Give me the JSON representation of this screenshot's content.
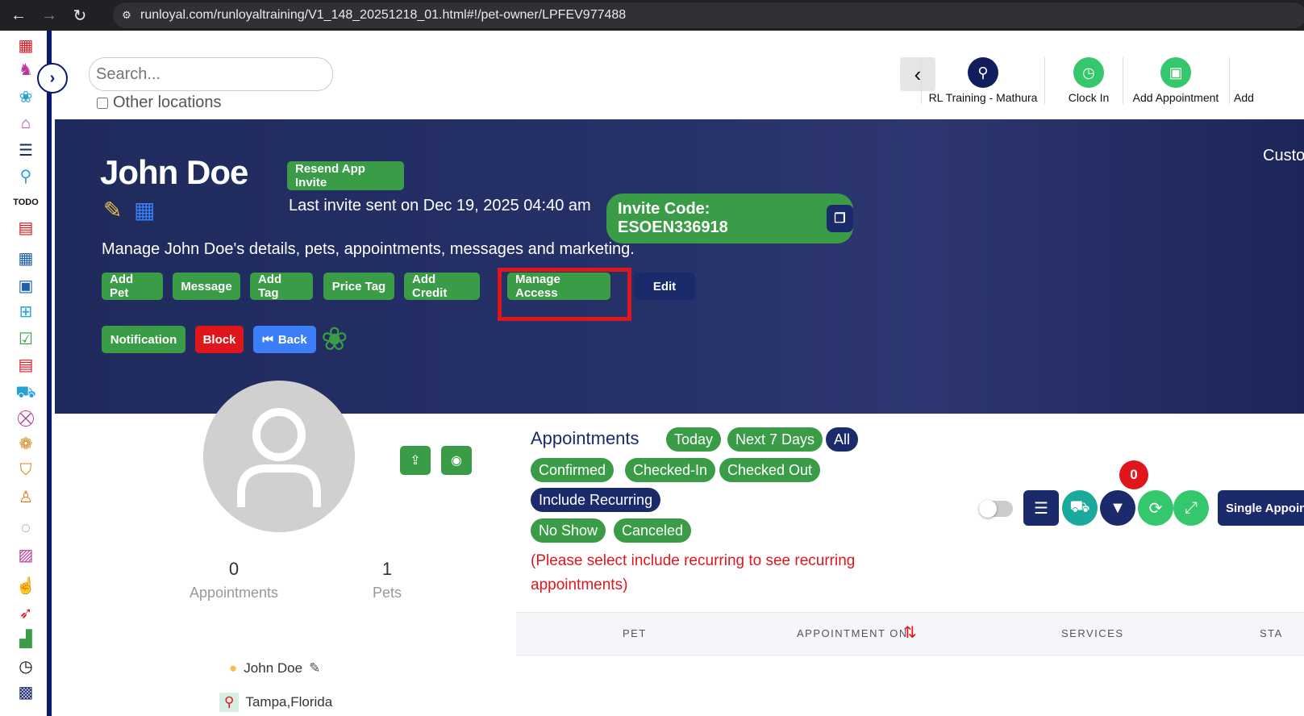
{
  "browser": {
    "url": "runloyal.com/runloyaltraining/V1_148_20251218_01.html#!/pet-owner/LPFEV977488"
  },
  "topbar": {
    "search_placeholder": "Search...",
    "other_locations_label": "Other locations",
    "location_label": "RL Training - Mathura",
    "clock_in_label": "Clock In",
    "add_appointment_label": "Add Appointment",
    "add_label": "Add"
  },
  "hero": {
    "owner_name": "John Doe",
    "resend_invite_label": "Resend App Invite",
    "last_invite_text": "Last invite sent on Dec 19, 2025 04:40 am",
    "invite_code_text": "Invite Code: ESOEN336918",
    "description": "Manage John Doe's details, pets, appointments, messages and marketing.",
    "right_partial_text": "Custo",
    "actions": [
      "Add Pet",
      "Message",
      "Add Tag",
      "Price Tag",
      "Add Credit",
      "Manage Access",
      "Edit"
    ],
    "actions2": [
      "Notification",
      "Block",
      "Back"
    ]
  },
  "profile": {
    "appointments_count": "0",
    "appointments_label": "Appointments",
    "pets_count": "1",
    "pets_label": "Pets",
    "owner_name": "John Doe",
    "location": "Tampa,Florida"
  },
  "appointments": {
    "title": "Appointments",
    "filters_row1": [
      "Today",
      "Next 7 Days",
      "All"
    ],
    "filters_row2": [
      "Confirmed",
      "Checked-In",
      "Checked Out"
    ],
    "include_recurring": "Include Recurring",
    "filters_row4": [
      "No Show",
      "Canceled"
    ],
    "recurring_note": "(Please select include recurring to see recurring appointments)",
    "filter_badge": "0",
    "single_appointment_label": "Single Appoin",
    "columns": [
      "PET",
      "APPOINTMENT ON",
      "SERVICES",
      "STA"
    ]
  },
  "colors": {
    "accent_green": "#3a9c47",
    "navy": "#1b2a6b",
    "danger": "#e0161d",
    "hero_bg": "#253067"
  }
}
